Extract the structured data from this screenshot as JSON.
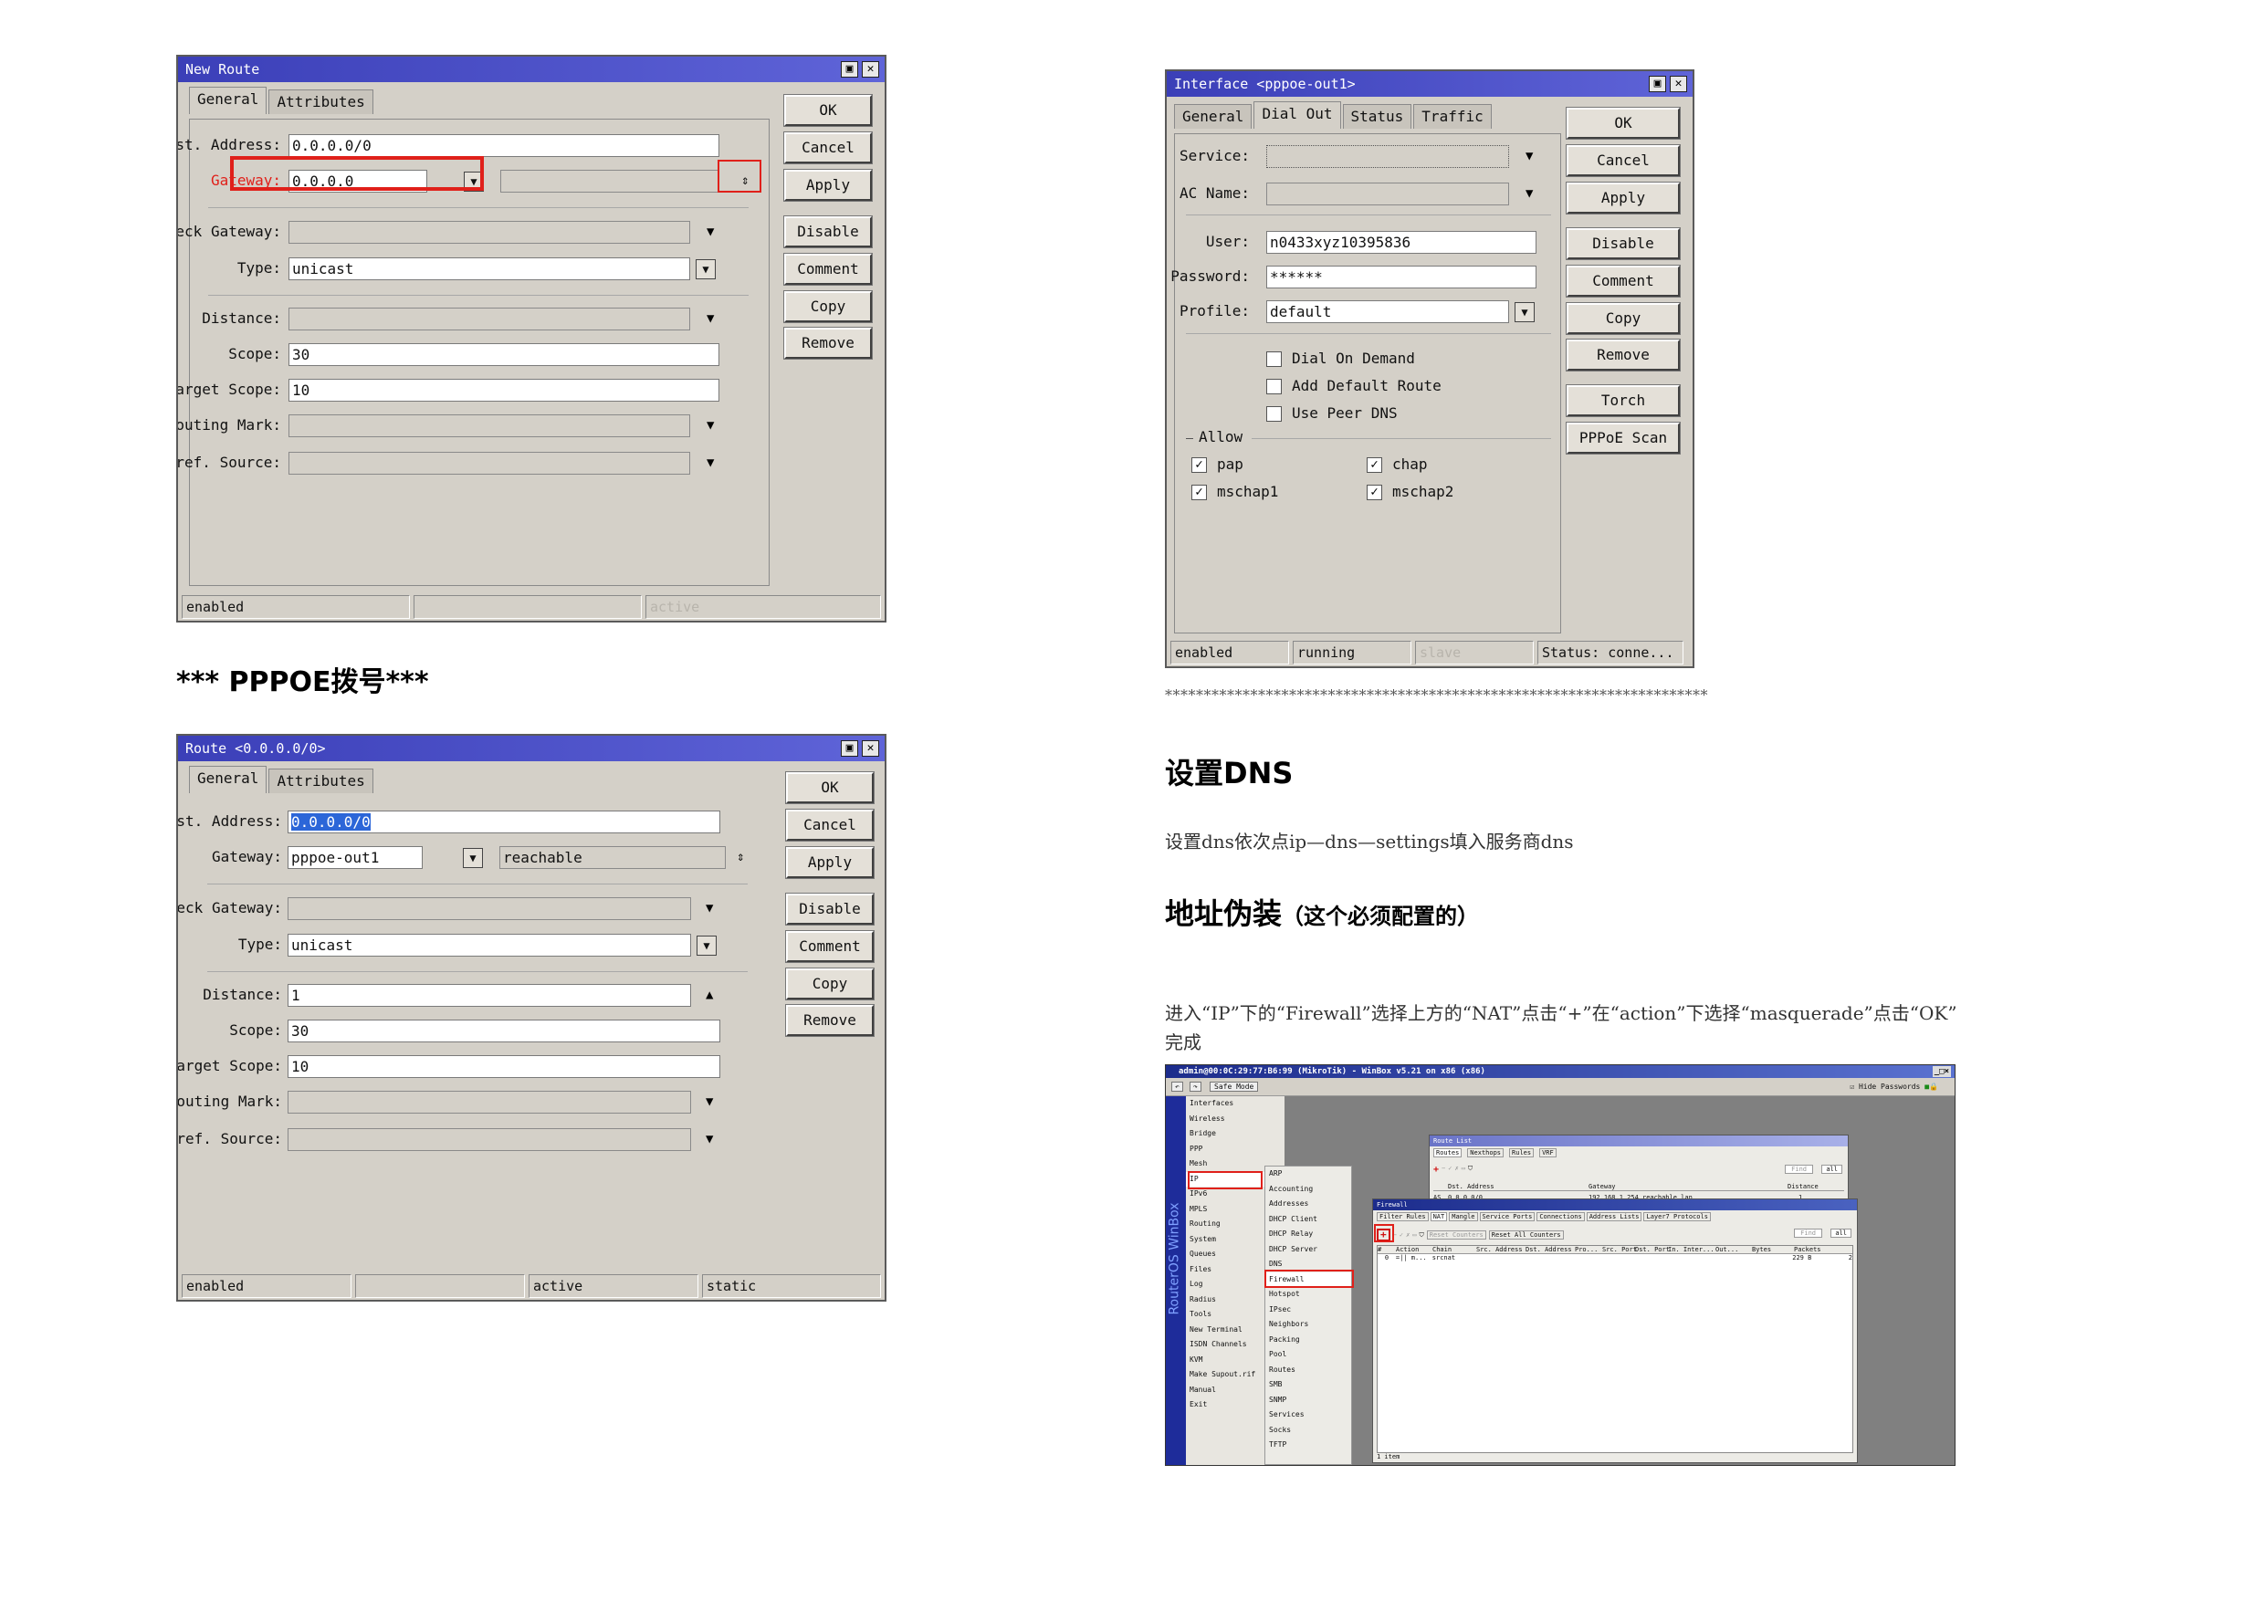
{
  "new_route": {
    "title": "New Route",
    "tabs": [
      "General",
      "Attributes"
    ],
    "labels": {
      "dst_address": "Dst. Address:",
      "gateway": "Gateway:",
      "check_gateway": "Check Gateway:",
      "type": "Type:",
      "distance": "Distance:",
      "scope": "Scope:",
      "target_scope": "Target Scope:",
      "routing_mark": "Routing Mark:",
      "pref_source": "Pref. Source:"
    },
    "values": {
      "dst_address": "0.0.0.0/0",
      "gateway": "0.0.0.0",
      "type": "unicast",
      "scope": "30",
      "target_scope": "10"
    },
    "buttons": [
      "OK",
      "Cancel",
      "Apply",
      "Disable",
      "Comment",
      "Copy",
      "Remove"
    ],
    "status": [
      "enabled",
      "",
      "active"
    ]
  },
  "pppoe_heading": "*** PPPOE拨号***",
  "route": {
    "title": "Route <0.0.0.0/0>",
    "tabs": [
      "General",
      "Attributes"
    ],
    "labels": {
      "dst_address": "Dst. Address:",
      "gateway": "Gateway:",
      "check_gateway": "Check Gateway:",
      "type": "Type:",
      "distance": "Distance:",
      "scope": "Scope:",
      "target_scope": "Target Scope:",
      "routing_mark": "Routing Mark:",
      "pref_source": "Pref. Source:"
    },
    "values": {
      "dst_address": "0.0.0.0/0",
      "gateway": "pppoe-out1",
      "gateway_state": "reachable",
      "type": "unicast",
      "distance": "1",
      "scope": "30",
      "target_scope": "10"
    },
    "buttons": [
      "OK",
      "Cancel",
      "Apply",
      "Disable",
      "Comment",
      "Copy",
      "Remove"
    ],
    "status": [
      "enabled",
      "",
      "active",
      "static"
    ]
  },
  "interface": {
    "title": "Interface <pppoe-out1>",
    "tabs": [
      "General",
      "Dial Out",
      "Status",
      "Traffic"
    ],
    "labels": {
      "service": "Service:",
      "ac_name": "AC Name:",
      "user": "User:",
      "password": "Password:",
      "profile": "Profile:"
    },
    "values": {
      "user": "n0433xyz10395836",
      "password": "******",
      "profile": "default"
    },
    "checkboxes": [
      {
        "label": "Dial On Demand",
        "checked": false
      },
      {
        "label": "Add Default Route",
        "checked": false
      },
      {
        "label": "Use Peer DNS",
        "checked": false
      }
    ],
    "allow_label": "Allow",
    "allow": [
      {
        "label": "pap",
        "checked": true
      },
      {
        "label": "chap",
        "checked": true
      },
      {
        "label": "mschap1",
        "checked": true
      },
      {
        "label": "mschap2",
        "checked": true
      }
    ],
    "buttons": [
      "OK",
      "Cancel",
      "Apply",
      "Disable",
      "Comment",
      "Copy",
      "Remove",
      "Torch",
      "PPPoE Scan"
    ],
    "status": [
      "enabled",
      "running",
      "slave",
      "Status: conne..."
    ]
  },
  "separator": "**********************************************************************",
  "dns_heading": "设置DNS",
  "dns_text": "设置dns依次点ip—dns—settings填入服务商dns",
  "masq_heading": "地址伪装",
  "masq_heading_note": "（这个必须配置的）",
  "masq_text_line1": "进入“IP”下的“Firewall”选择上方的“NAT”点击“+”在“action”下选择“masquerade”点击“OK”",
  "masq_text_line2": "完成",
  "winbox": {
    "title": "admin@00:0C:29:77:B6:99 (MikroTik) - WinBox v5.21 on x86 (x86)",
    "safe_mode": "Safe Mode",
    "hide_passwords": "Hide Passwords",
    "brand": "RouterOS WinBox",
    "menu": [
      "Interfaces",
      "Wireless",
      "Bridge",
      "PPP",
      "Mesh",
      "IP",
      "IPv6",
      "MPLS",
      "Routing",
      "System",
      "Queues",
      "Files",
      "Log",
      "Radius",
      "Tools",
      "New Terminal",
      "ISDN Channels",
      "KVM",
      "Make Supout.rif",
      "Manual",
      "Exit"
    ],
    "ip_submenu": [
      "ARP",
      "Accounting",
      "Addresses",
      "DHCP Client",
      "DHCP Relay",
      "DHCP Server",
      "DNS",
      "Firewall",
      "Hotspot",
      "IPsec",
      "Neighbors",
      "Packing",
      "Pool",
      "Routes",
      "SMB",
      "SNMP",
      "Services",
      "Socks",
      "TFTP"
    ],
    "route_list": {
      "title": "Route List",
      "tabs": [
        "Routes",
        "Nexthops",
        "Rules",
        "VRF"
      ],
      "columns": [
        "Dst. Address",
        "Gateway",
        "Distance"
      ],
      "row": {
        "flags": "AS",
        "dst": "0.0.0.0/0",
        "gateway": "192.168.1.254 reachable lan",
        "distance": "1"
      },
      "find": "Find",
      "filter": "all"
    },
    "firewall": {
      "title": "Firewall",
      "tabs": [
        "Filter Rules",
        "NAT",
        "Mangle",
        "Service Ports",
        "Connections",
        "Address Lists",
        "Layer7 Protocols"
      ],
      "reset_counters": "Reset Counters",
      "reset_all_counters": "Reset All Counters",
      "find": "Find",
      "filter": "all",
      "columns": [
        "#",
        "Action",
        "Chain",
        "Src. Address",
        "Dst. Address",
        "Pro...",
        "Src. Port",
        "Dst. Port",
        "In. Inter...",
        "Out...",
        "Bytes",
        "Packets"
      ],
      "row": {
        "num": "0",
        "action": "=|| m...",
        "chain": "srcnat",
        "bytes": "229 B",
        "packets": "2"
      },
      "footer": "1 item"
    }
  }
}
